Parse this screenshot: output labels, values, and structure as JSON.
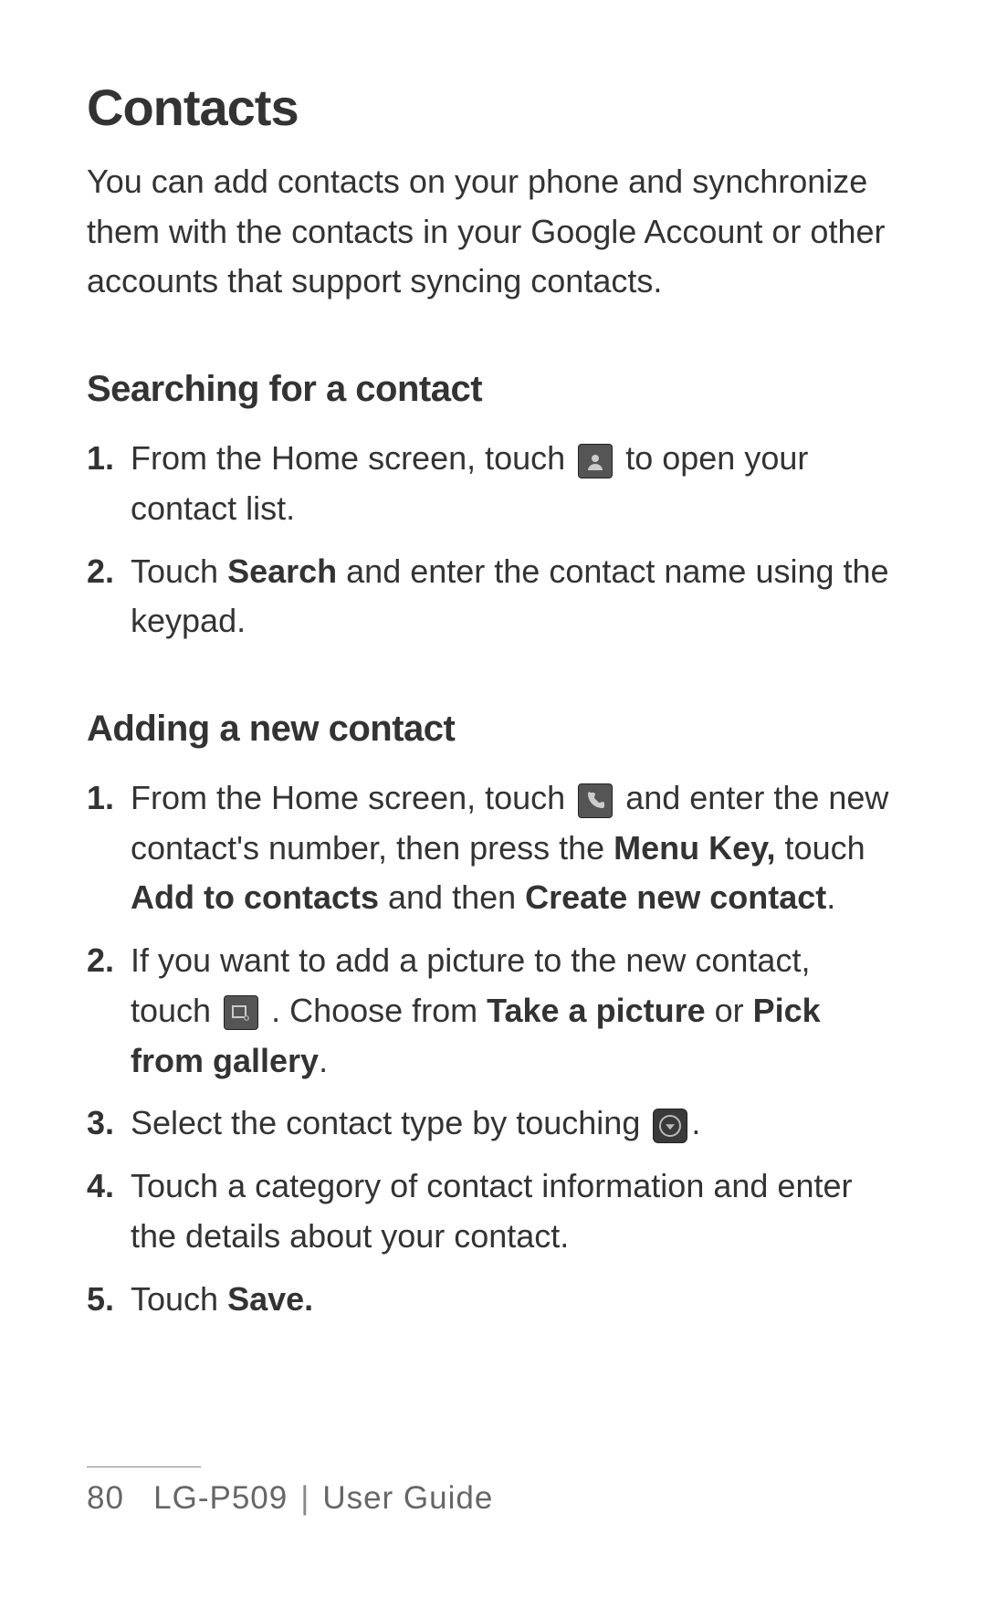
{
  "title": "Contacts",
  "intro": "You can add contacts on your phone and synchronize them with the contacts in your Google Account or other accounts that support syncing contacts.",
  "section1": {
    "heading": "Searching for a contact",
    "items": {
      "step1_a": "From the Home screen, touch ",
      "step1_b": " to open your contact list.",
      "step2_a": "Touch ",
      "step2_bold_search": "Search",
      "step2_b": " and enter the contact name using the keypad."
    }
  },
  "section2": {
    "heading": "Adding a new contact",
    "items": {
      "step1_a": "From the Home screen, touch ",
      "step1_b": " and enter the new contact's number, then press the ",
      "step1_bold_menukey": "Menu Key,",
      "step1_c": " touch ",
      "step1_bold_add": "Add to contacts",
      "step1_d": " and then ",
      "step1_bold_create": "Create new contact",
      "step1_e": ".",
      "step2_a": "If you want to add a picture to the new contact, touch ",
      "step2_b": " . Choose from ",
      "step2_bold_take": "Take a picture",
      "step2_c": " or ",
      "step2_bold_pick": "Pick from gallery",
      "step2_d": ".",
      "step3_a": "Select the contact type by touching ",
      "step3_b": ".",
      "step4": "Touch a category of contact information and enter the details about your contact.",
      "step5_a": "Touch ",
      "step5_bold_save": "Save."
    }
  },
  "footer": {
    "page": "80",
    "model": "LG-P509",
    "label": "User Guide"
  }
}
